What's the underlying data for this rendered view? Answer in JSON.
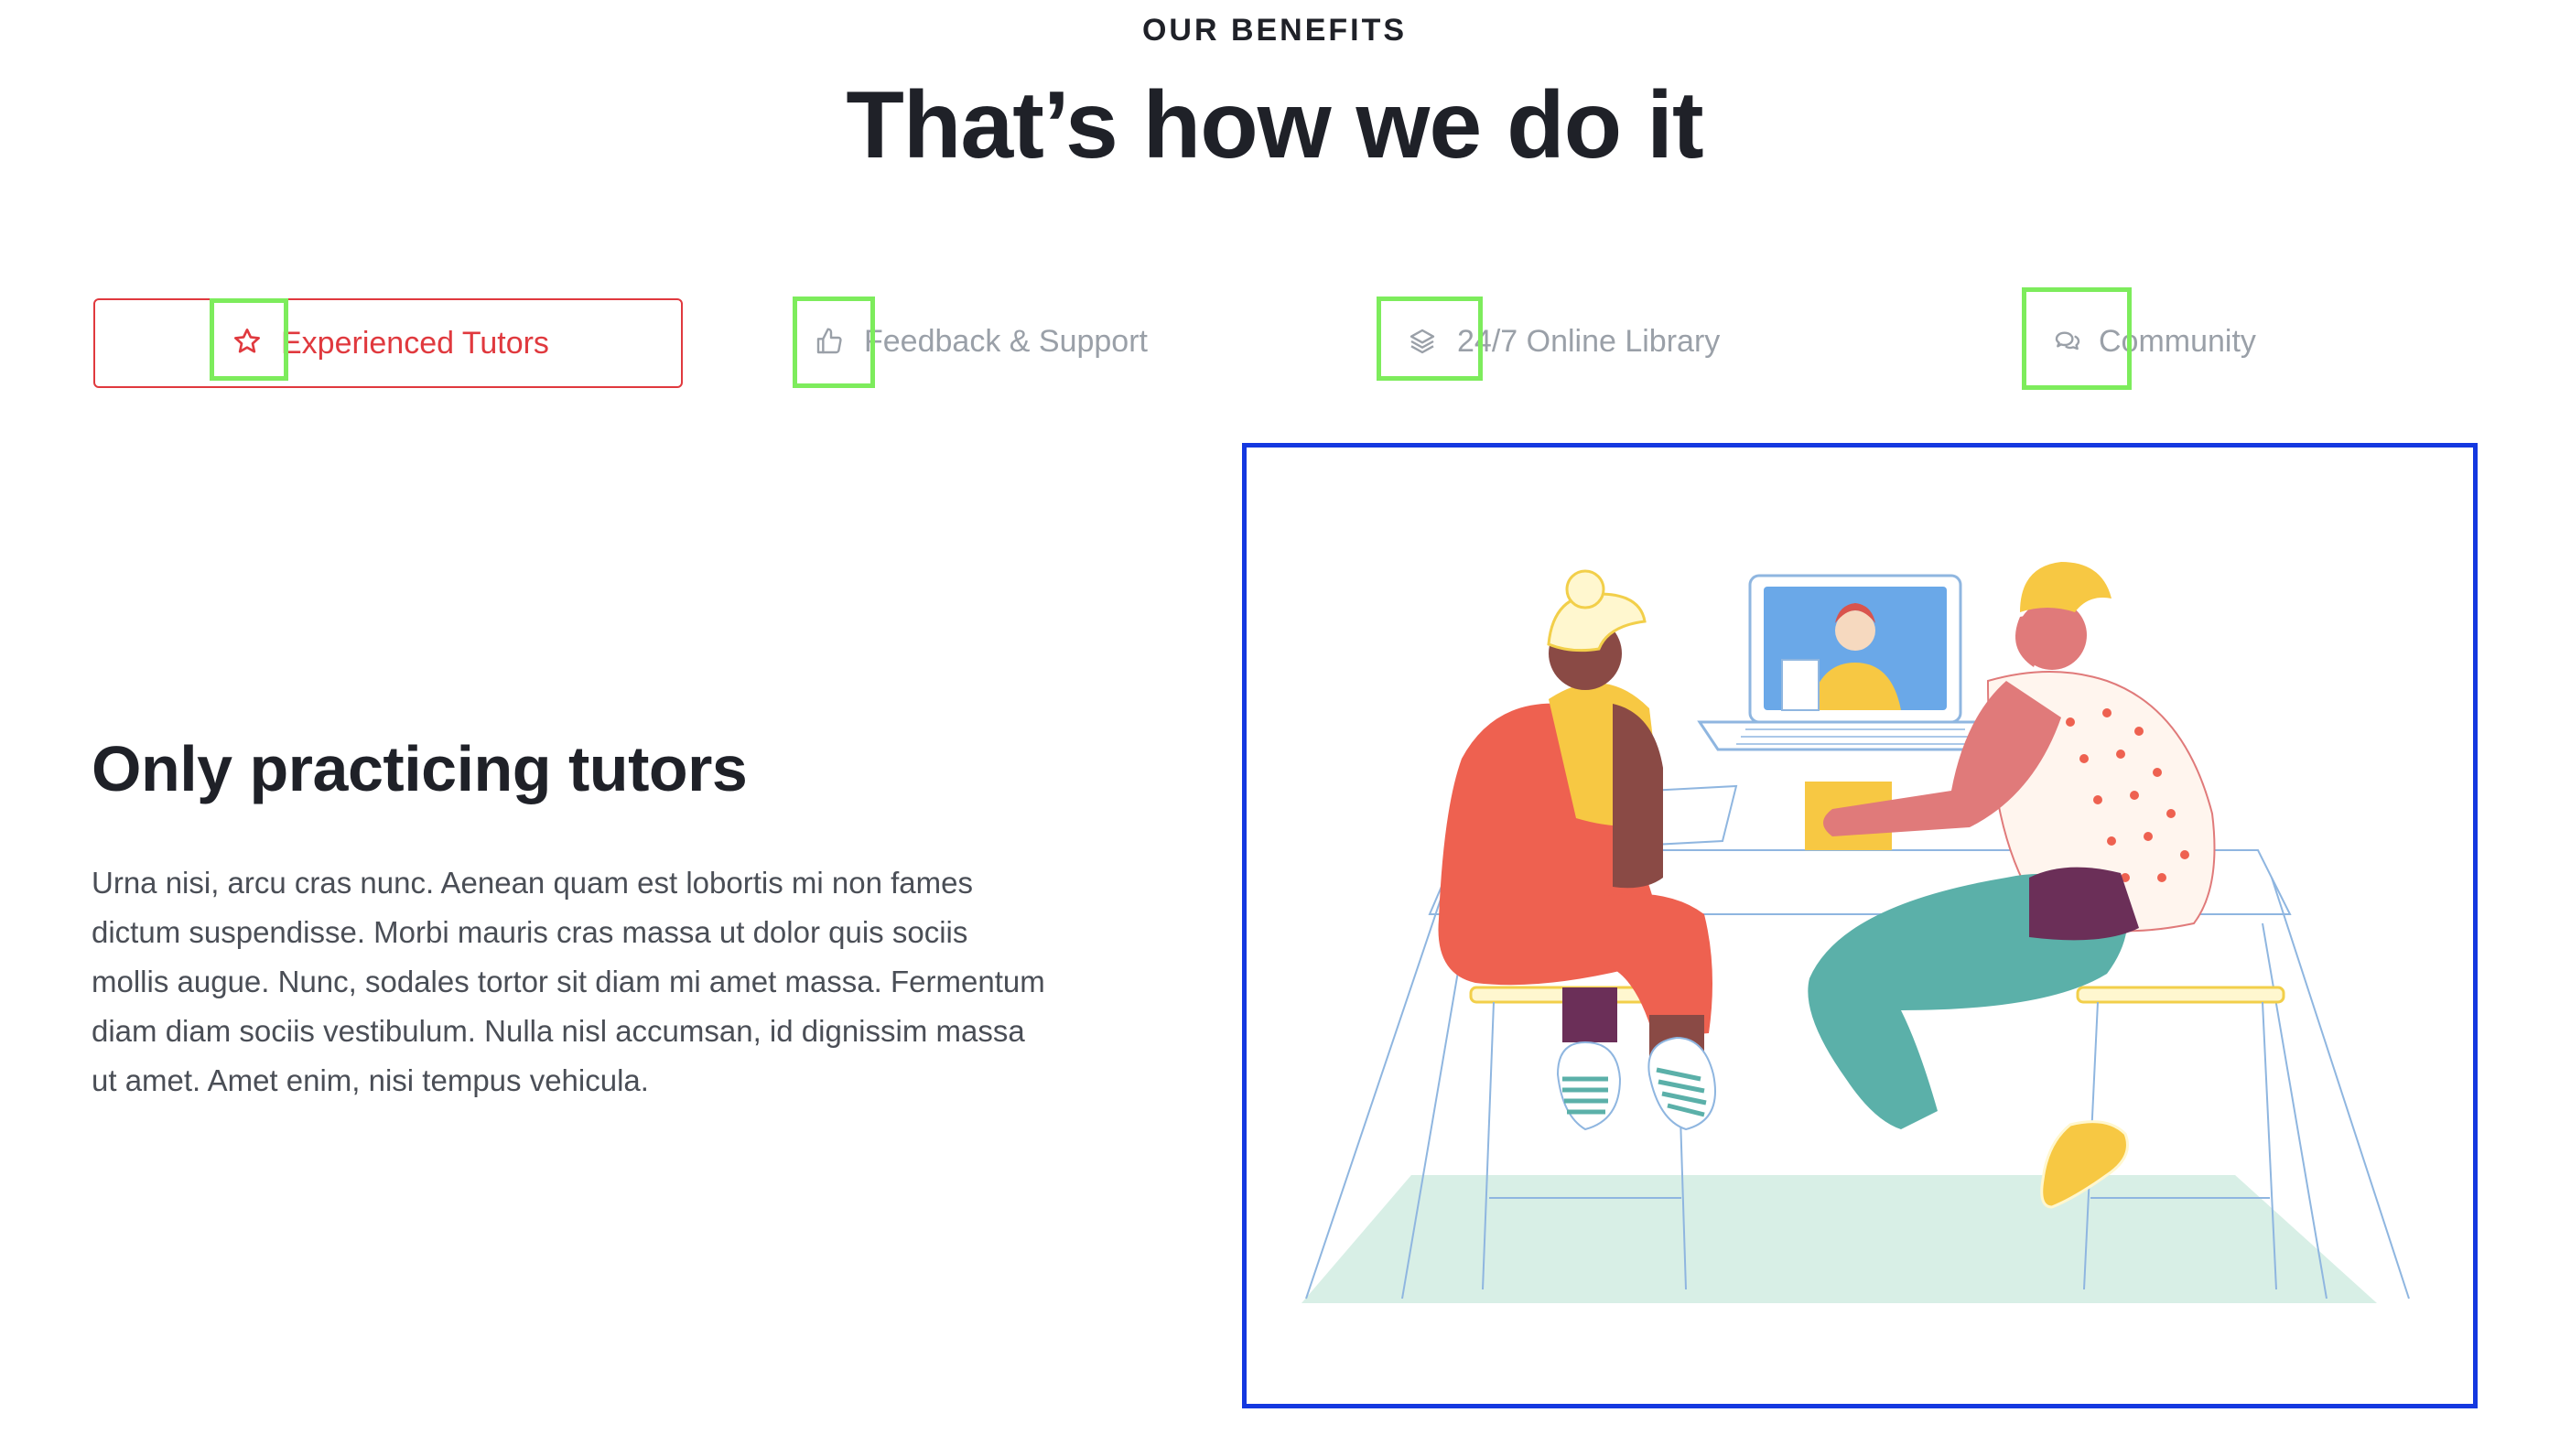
{
  "section": {
    "eyebrow": "OUR BENEFITS",
    "title": "That’s how we do it"
  },
  "tabs": [
    {
      "label": "Experienced Tutors",
      "icon": "star-icon",
      "active": true
    },
    {
      "label": "Feedback & Support",
      "icon": "thumbs-up-icon",
      "active": false
    },
    {
      "label": "24/7 Online Library",
      "icon": "layers-icon",
      "active": false
    },
    {
      "label": "Community",
      "icon": "chat-bubbles-icon",
      "active": false
    }
  ],
  "content": {
    "heading": "Only practicing tutors",
    "paragraph": "Urna nisi, arcu cras nunc. Aenean quam est lobortis mi non fames dictum suspendisse. Morbi mauris cras massa ut dolor quis sociis mollis augue. Nunc, sodales tortor sit diam mi amet massa. Fermentum diam diam sociis vestibulum. Nulla nisl accumsan, id dignissim massa ut amet. Amet enim, nisi tempus vehicula."
  },
  "colors": {
    "accent": "#e0393e",
    "text_dark": "#1f2128",
    "text_muted": "#9aa0a8",
    "highlight_green": "#7dec5c",
    "frame_blue": "#1438e0"
  }
}
